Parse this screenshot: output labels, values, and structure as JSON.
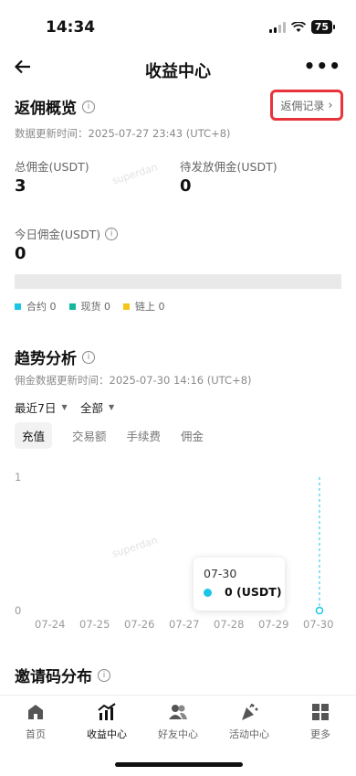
{
  "status": {
    "time": "14:34",
    "battery": "75"
  },
  "header": {
    "title": "收益中心",
    "back_icon": "arrow-left-icon",
    "more_icon": "more-dots-icon"
  },
  "overview": {
    "title": "返佣概览",
    "update_time": "数据更新时间：2025-07-27 23:43 (UTC+8)",
    "records_label": "返佣记录",
    "total_label": "总佣金(USDT)",
    "total_value": "3",
    "pending_label": "待发放佣金(USDT)",
    "pending_value": "0",
    "today_label": "今日佣金(USDT)",
    "today_value": "0",
    "watermark": "superdan",
    "legend": [
      {
        "label": "合约 0",
        "color": "#19c6e6"
      },
      {
        "label": "现货 0",
        "color": "#12b89f"
      },
      {
        "label": "链上 0",
        "color": "#f5c518"
      }
    ]
  },
  "trend": {
    "title": "趋势分析",
    "update_time": "佣金数据更新时间：2025-07-30 14:16 (UTC+8)",
    "range_select": "最近7日",
    "type_select": "全部",
    "tabs": [
      "充值",
      "交易额",
      "手续费",
      "佣金"
    ],
    "active_tab": 0,
    "watermark": "superdan",
    "tooltip": {
      "date": "07-30",
      "value": "0 (USDT)"
    }
  },
  "chart_data": {
    "type": "line",
    "categories": [
      "07-24",
      "07-25",
      "07-26",
      "07-27",
      "07-28",
      "07-29",
      "07-30"
    ],
    "series": [
      {
        "values": [
          0,
          0,
          0,
          0,
          0,
          0,
          0
        ],
        "color": "#19c6e6"
      }
    ],
    "ylim": [
      0,
      1
    ],
    "yticks": [
      "0",
      "1"
    ],
    "highlight_index": 6
  },
  "invite": {
    "title": "邀请码分布"
  },
  "tabbar": [
    {
      "label": "首页",
      "icon": "home-icon"
    },
    {
      "label": "收益中心",
      "icon": "chart-icon"
    },
    {
      "label": "好友中心",
      "icon": "friends-icon"
    },
    {
      "label": "活动中心",
      "icon": "party-icon"
    },
    {
      "label": "更多",
      "icon": "grid-icon"
    }
  ],
  "active_tabbar": 1
}
